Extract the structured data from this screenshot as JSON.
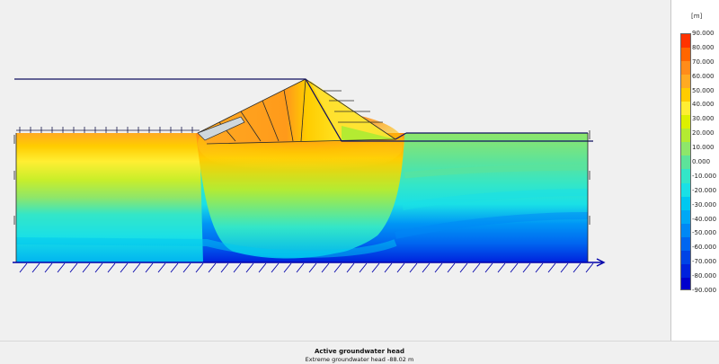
{
  "legend": {
    "unit": "[m]",
    "labels": [
      "90.000",
      "80.000",
      "70.000",
      "60.000",
      "50.000",
      "40.000",
      "30.000",
      "20.000",
      "10.000",
      "0.000",
      "-10.000",
      "-20.000",
      "-30.000",
      "-40.000",
      "-50.000",
      "-60.000",
      "-70.000",
      "-80.000",
      "-90.000"
    ],
    "colors": [
      "#ff3300",
      "#ff6600",
      "#ff8c1a",
      "#ffaa22",
      "#ffcc00",
      "#ffee33",
      "#ddf000",
      "#b4eb32",
      "#8ee66a",
      "#5de39a",
      "#33e6c8",
      "#1ae0e6",
      "#00c8f0",
      "#00a8f5",
      "#0088f5",
      "#0066f0",
      "#0044e6",
      "#0022dd",
      "#0000cc"
    ]
  },
  "caption": {
    "title": "Active groundwater head",
    "subtitle": "Extreme groundwater head -88.02 m"
  }
}
